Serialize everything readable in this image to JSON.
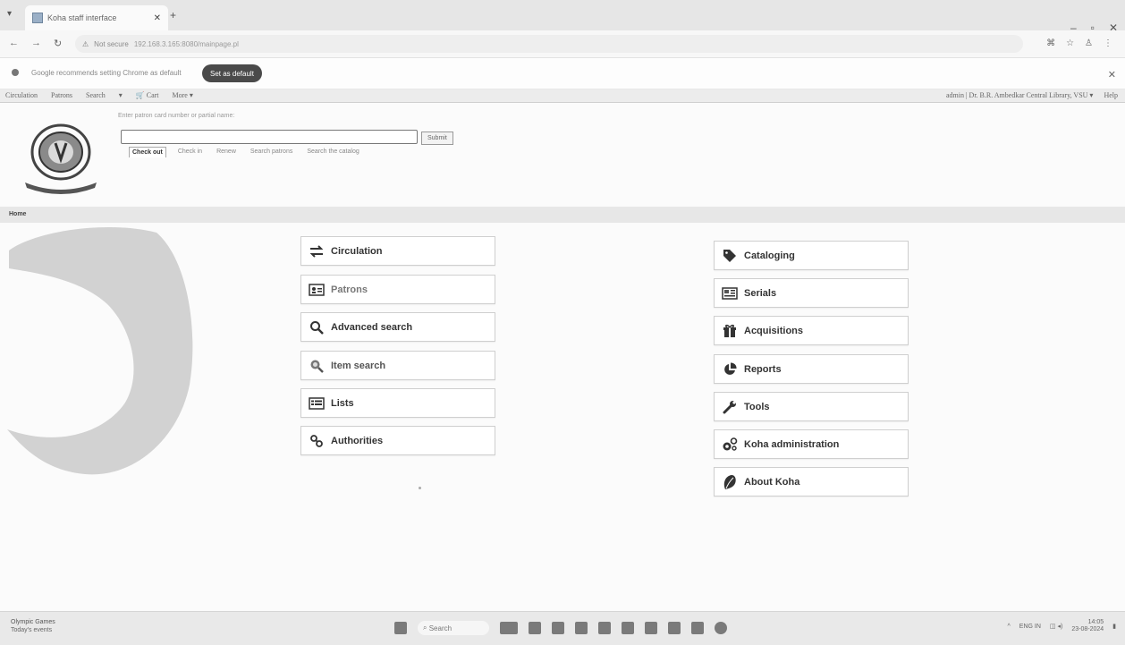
{
  "browser": {
    "tab_title": "Koha staff interface",
    "url_warning": "Not secure",
    "url": "192.168.3.165:8080/mainpage.pl",
    "infobar_message": "Google recommends setting Chrome as default",
    "infobar_button": "Set as default"
  },
  "koha_nav": {
    "items": [
      "Circulation",
      "Patrons",
      "Search",
      "▾",
      "🛒 Cart",
      "More ▾"
    ],
    "user": "admin | Dr. B.R. Ambedkar Central Library, VSU ▾",
    "help": "Help"
  },
  "checkout": {
    "hint": "Enter patron card number or partial name:",
    "submit": "Submit",
    "tabs": [
      "Check out",
      "Check in",
      "Renew",
      "Search patrons",
      "Search the catalog"
    ]
  },
  "breadcrumb": "Home",
  "modules_left": [
    {
      "label": "Circulation",
      "icon": "exchange-icon"
    },
    {
      "label": "Patrons",
      "icon": "id-card-icon"
    },
    {
      "label": "Advanced search",
      "icon": "search-icon"
    },
    {
      "label": "Item search",
      "icon": "item-search-icon"
    },
    {
      "label": "Lists",
      "icon": "list-icon"
    },
    {
      "label": "Authorities",
      "icon": "link-icon"
    }
  ],
  "modules_right": [
    {
      "label": "Cataloging",
      "icon": "tag-icon"
    },
    {
      "label": "Serials",
      "icon": "newspaper-icon"
    },
    {
      "label": "Acquisitions",
      "icon": "gift-icon"
    },
    {
      "label": "Reports",
      "icon": "pie-chart-icon"
    },
    {
      "label": "Tools",
      "icon": "wrench-icon"
    },
    {
      "label": "Koha administration",
      "icon": "cogs-icon"
    },
    {
      "label": "About Koha",
      "icon": "koha-leaf-icon"
    }
  ],
  "taskbar": {
    "weather_line1": "Olympic Games",
    "weather_line2": "Today's events",
    "search": "Search",
    "lang": "ENG IN",
    "time": "14:05",
    "date": "23-08-2024"
  }
}
